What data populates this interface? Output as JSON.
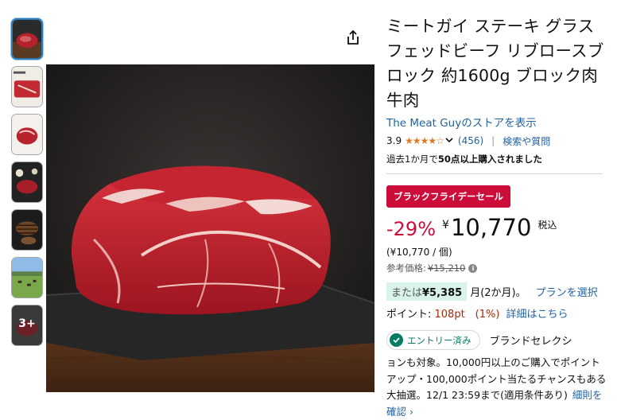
{
  "product": {
    "title": "ミートガイ ステーキ グラスフェッドビーフ リブロースブロック 約1600g ブロック肉 牛肉",
    "store_link": "The Meat Guyのストアを表示",
    "rating": "3.9",
    "stars": "★★★★☆",
    "review_count": "(456)",
    "qa_link": "検索や質問",
    "bought_prefix": "過去1か月で",
    "bought_bold": "50点以上購入されました"
  },
  "deal": {
    "badge": "ブラックフライデーセール",
    "discount": "-29%",
    "currency": "¥",
    "price": "10,770",
    "tax_label": "税込",
    "unit_price": "(¥10,770 / 個)",
    "ref_label": "参考価格:",
    "ref_price": "¥15,210"
  },
  "installment": {
    "prefix": "または",
    "amount": "¥5,385",
    "suffix": "月(2か月)。",
    "plan_link": "プランを選択"
  },
  "points": {
    "label": "ポイント: ",
    "value": "108pt　(1%)",
    "link": "詳細はこちら"
  },
  "campaign": {
    "entry_label": "エントリー済み",
    "brand_text": "ブランドセレクシ",
    "desc": "ョンも対象。10,000円以上のご購入でポイントアップ・100,000ポイント当たるチャンスもある大抽選。12/1 23:59まで(適用条件あり)",
    "desc_link": "細則を確認 ›"
  },
  "gallery": {
    "more_label": "3+"
  },
  "colors": {
    "accent_link": "#2162a1",
    "deal_red": "#cc0c39",
    "star_orange": "#de7921",
    "check_green": "#067d62"
  },
  "icons": [
    "share-icon",
    "chevron-down-icon",
    "info-icon",
    "check-icon"
  ]
}
